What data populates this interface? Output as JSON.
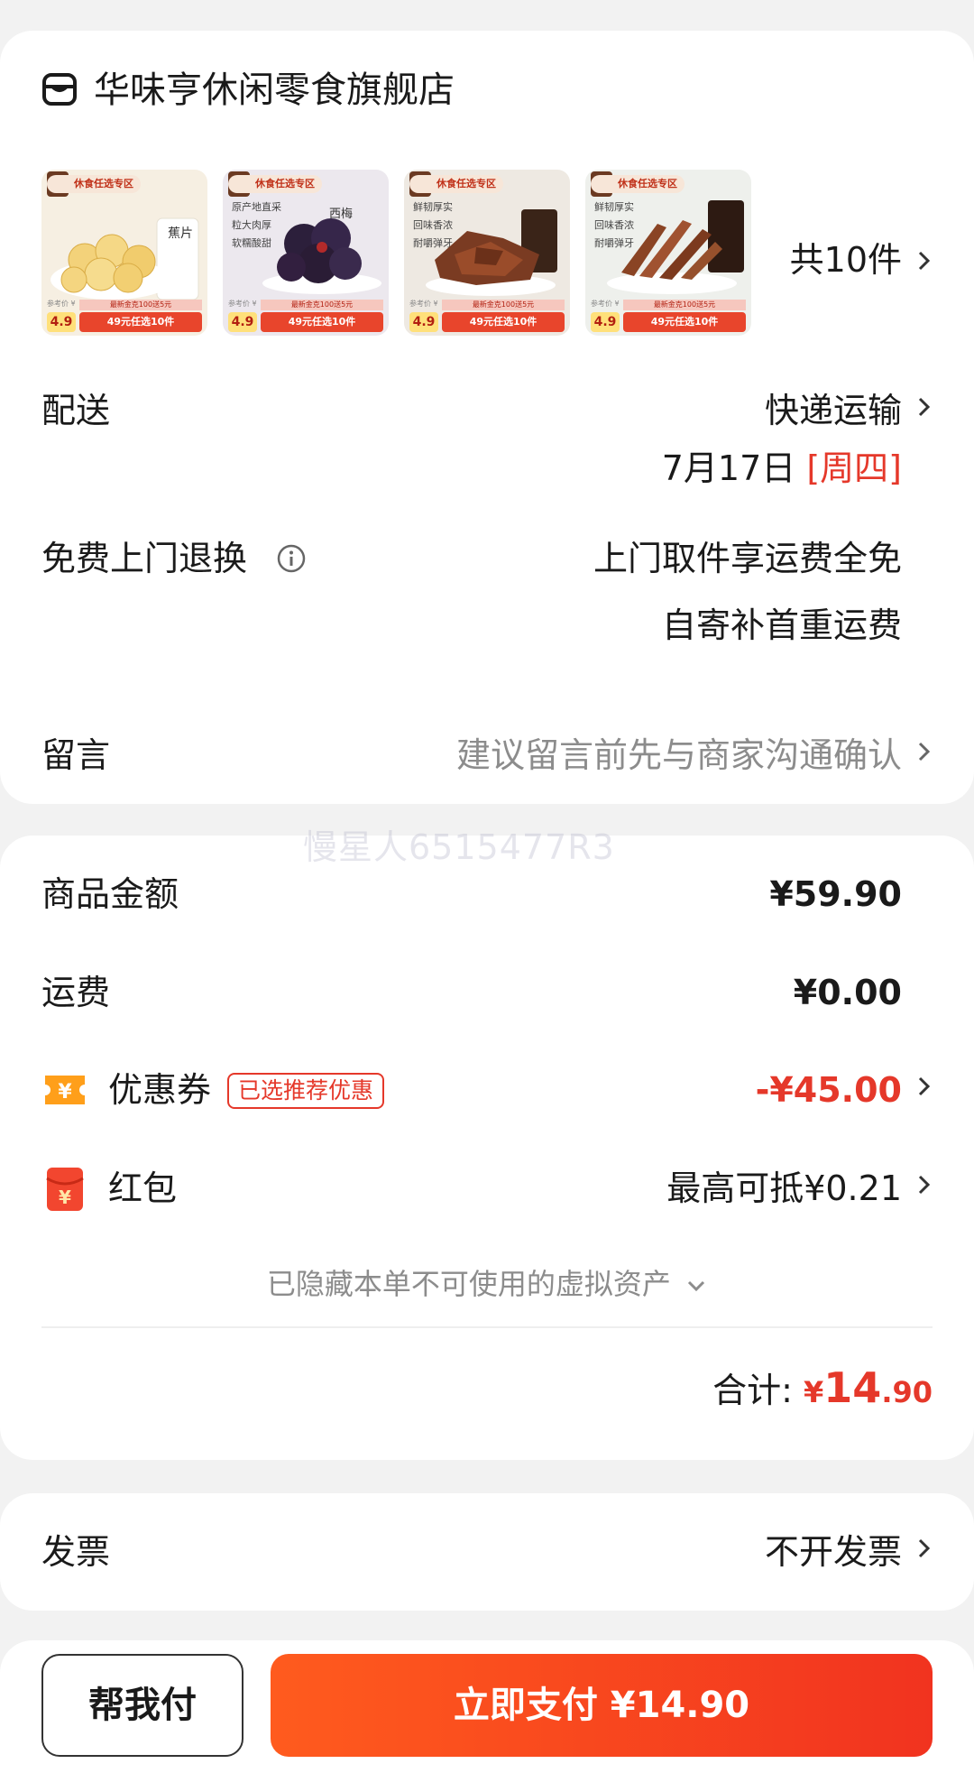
{
  "store": {
    "name": "华味亨休闲零食旗舰店",
    "item_count": "共10件",
    "thumbnails": [
      {
        "tag": "休食任选专区",
        "features": [],
        "label": "蕉片",
        "price": "4.9",
        "promo": "49元任选10件",
        "promo_top": "最新金克100送5元",
        "ref": "参考价 ¥"
      },
      {
        "tag": "休食任选专区",
        "features": [
          "原产地直采",
          "粒大肉厚",
          "软糯酸甜"
        ],
        "label": "西梅",
        "price": "4.9",
        "promo": "49元任选10件",
        "promo_top": "最新金克100送5元",
        "ref": "参考价 ¥"
      },
      {
        "tag": "休食任选专区",
        "features": [
          "鲜韧厚实",
          "回味香浓",
          "耐嚼弹牙"
        ],
        "label": "",
        "price": "4.9",
        "promo": "49元任选10件",
        "promo_top": "最新金克100送5元",
        "ref": "参考价 ¥"
      },
      {
        "tag": "休食任选专区",
        "features": [
          "鲜韧厚实",
          "回味香浓",
          "耐嚼弹牙"
        ],
        "label": "",
        "price": "4.9",
        "promo": "49元任选10件",
        "promo_top": "最新金克100送5元",
        "ref": "参考价 ¥"
      }
    ]
  },
  "delivery": {
    "label": "配送",
    "method": "快递运输",
    "date": "7月17日",
    "weekday": "[周四]"
  },
  "returns": {
    "label": "免费上门退换",
    "line1": "上门取件享运费全免",
    "line2": "自寄补首重运费"
  },
  "message": {
    "label": "留言",
    "placeholder": "建议留言前先与商家沟通确认"
  },
  "watermark": "慢星人6515477R3",
  "price": {
    "goods_label": "商品金额",
    "goods_value": "¥59.90",
    "shipping_label": "运费",
    "shipping_value": "¥0.00",
    "coupon_label": "优惠券",
    "coupon_badge": "已选推荐优惠",
    "coupon_value": "-¥45.00",
    "redpacket_label": "红包",
    "redpacket_value": "最高可抵¥0.21",
    "hidden_assets": "已隐藏本单不可使用的虚拟资产",
    "total_label": "合计:",
    "total_currency": "¥",
    "total_int": "14",
    "total_dec": ".90"
  },
  "invoice": {
    "label": "发票",
    "value": "不开发票"
  },
  "actions": {
    "help_pay": "帮我付",
    "pay_now": "立即支付 ¥14.90"
  },
  "colors": {
    "accent_red": "#e5382a",
    "pay_gradient_start": "#ff5b1e",
    "pay_gradient_end": "#f1331f"
  }
}
